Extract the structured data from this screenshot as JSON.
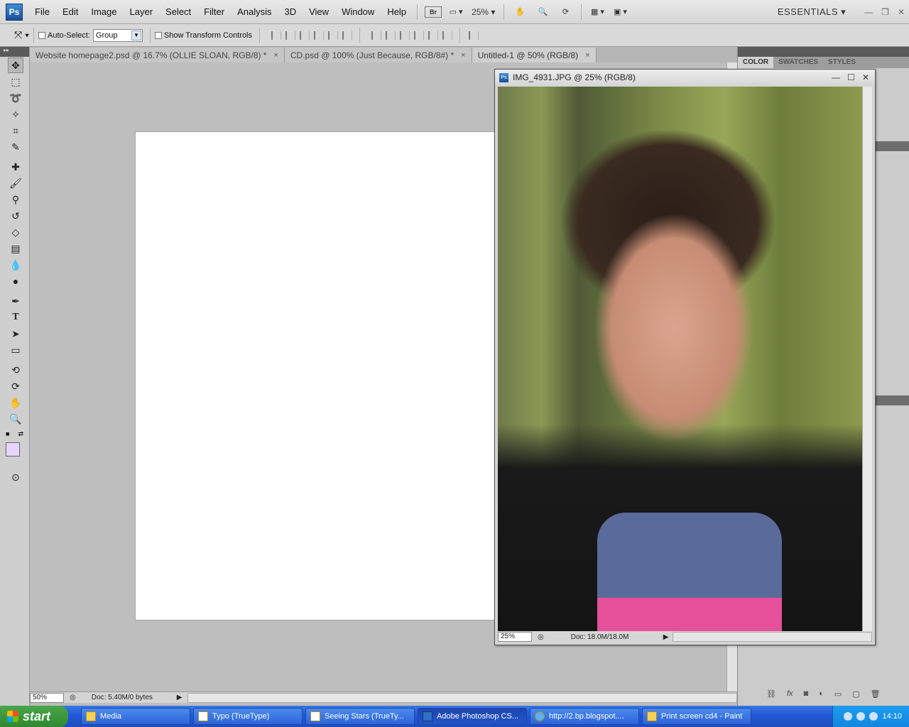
{
  "menubar": {
    "logo": "Ps",
    "items": [
      "File",
      "Edit",
      "Image",
      "Layer",
      "Select",
      "Filter",
      "Analysis",
      "3D",
      "View",
      "Window",
      "Help"
    ],
    "bridge": "Br",
    "zoom": "25%",
    "workspace": "ESSENTIALS"
  },
  "options": {
    "auto_select_label": "Auto-Select:",
    "auto_select_value": "Group",
    "show_transform_label": "Show Transform Controls"
  },
  "tabs": [
    {
      "label": "Website homepage2.psd @ 16.7% (OLLIE SLOAN, RGB/8) *"
    },
    {
      "label": "CD.psd @ 100% (Just Because, RGB/8#) *"
    },
    {
      "label": "Untitled-1 @ 50% (RGB/8)"
    }
  ],
  "tab_close": "×",
  "tools": [
    "move",
    "marquee",
    "lasso",
    "magic-wand",
    "crop",
    "eyedropper",
    "healing",
    "brush",
    "clone-stamp",
    "history-brush",
    "eraser",
    "gradient",
    "blur",
    "dodge",
    "pen",
    "type",
    "path-select",
    "shape",
    "3d-rotate",
    "3d-orbit",
    "hand",
    "zoom"
  ],
  "colors": {
    "foreground": "#e8d4ff",
    "background": "#ffffff"
  },
  "status": {
    "zoom": "50%",
    "doc": "Doc: 5.40M/0 bytes"
  },
  "panel_tabs": [
    "COLOR",
    "SWATCHES",
    "STYLES"
  ],
  "image_window": {
    "title": "IMG_4931.JPG @ 25% (RGB/8)",
    "zoom": "25%",
    "doc": "Doc: 18.0M/18.0M"
  },
  "taskbar": {
    "start": "start",
    "items": [
      {
        "label": "Media"
      },
      {
        "label": "Typo (TrueType)"
      },
      {
        "label": "Seeing Stars (TrueTy..."
      },
      {
        "label": "Adobe Photoshop CS..."
      },
      {
        "label": "http://2.bp.blogspot...."
      },
      {
        "label": "Print screen cd4 - Paint"
      }
    ],
    "clock": "14:10"
  }
}
